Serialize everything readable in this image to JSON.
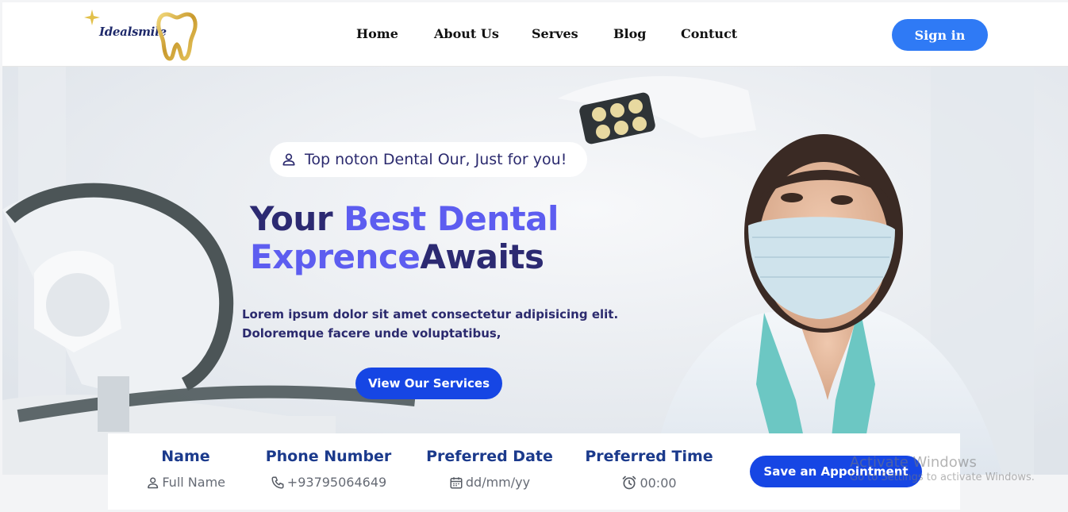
{
  "brand": {
    "name": "Idealsmile"
  },
  "nav": {
    "home": "Home",
    "about": "About Us",
    "serves": "Serves",
    "blog": "Blog",
    "contact": "Contuct"
  },
  "header": {
    "signin_label": "Sign in"
  },
  "hero": {
    "tagline": "Top noton Dental Our, Just for you!",
    "title_part1": "Your ",
    "title_part2": "Best Dental",
    "title_part3": "Exprence",
    "title_part4": "Awaits",
    "description_line1": "Lorem ipsum dolor sit amet consectetur adipisicing elit.",
    "description_line2": "Doloremque facere unde voluptatibus,",
    "services_button": "View Our Services"
  },
  "appointment": {
    "name": {
      "label": "Name",
      "placeholder": "Full Name",
      "icon": "user-icon"
    },
    "phone": {
      "label": "Phone Number",
      "placeholder": "+93795064649",
      "icon": "phone-icon"
    },
    "date": {
      "label": "Preferred Date",
      "placeholder": "dd/mm/yy",
      "icon": "calendar-icon"
    },
    "time": {
      "label": "Preferred Time",
      "placeholder": "00:00",
      "icon": "alarm-clock-icon"
    },
    "save_button": "Save an Appointment"
  },
  "watermark": {
    "line1": "Activate Windows",
    "line2": "Go to Settings to activate Windows."
  },
  "colors": {
    "primary_blue": "#1646e4",
    "signin_blue": "#2f7af5",
    "title_dark": "#2c2a72",
    "title_accent": "#5d5df0",
    "label_blue": "#1b3a8c"
  }
}
